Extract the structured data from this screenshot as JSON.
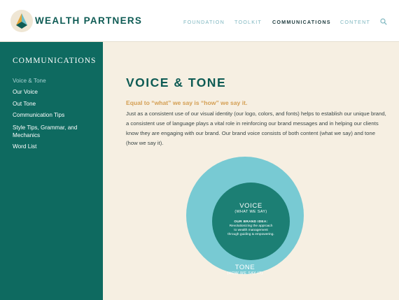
{
  "header": {
    "brand": "WEALTH PARTNERS",
    "nav": [
      "FOUNDATION",
      "TOOLKIT",
      "COMMUNICATIONS",
      "CONTENT"
    ],
    "active_nav": "COMMUNICATIONS",
    "search_icon": "search-icon"
  },
  "sidebar": {
    "title": "COMMUNICATIONS",
    "items": [
      {
        "label": "Voice & Tone",
        "active": true
      },
      {
        "label": "Our Voice"
      },
      {
        "label": "Out Tone"
      },
      {
        "label": "Communication Tips"
      },
      {
        "label": "Style Tips, Grammar, and Mechanics"
      },
      {
        "label": "Word List"
      }
    ]
  },
  "main": {
    "title": "VOICE & TONE",
    "subtitle": "Equal to “what” we say is “how” we say it.",
    "body": "Just as a consistent use of our visual identity (our logo, colors, and fonts) helps to establish our unique brand, a consistent use of language plays a vital role in reinforcing our brand messages and in helping our clients know they are engaging with our brand. Our brand voice consists of both content (what we say) and tone (how we say it)."
  },
  "diagram": {
    "voice": "VOICE",
    "voice_sub": "(WHAT WE SAY)",
    "idea_label": "OUR BRAND IDEA:",
    "idea_line1": "Revolutionizing the approach",
    "idea_line2": "to wealth management",
    "idea_line3": "through guiding & empowering.",
    "tone": "TONE",
    "tone_sub": "(HOW WE SAY IT)"
  },
  "colors": {
    "brand": "#0e5b54",
    "sidebar": "#0e6a60",
    "accent": "#d49e52",
    "outer_circle": "#78cad3",
    "inner_circle": "#1c7f74",
    "background": "#f6efe2"
  }
}
